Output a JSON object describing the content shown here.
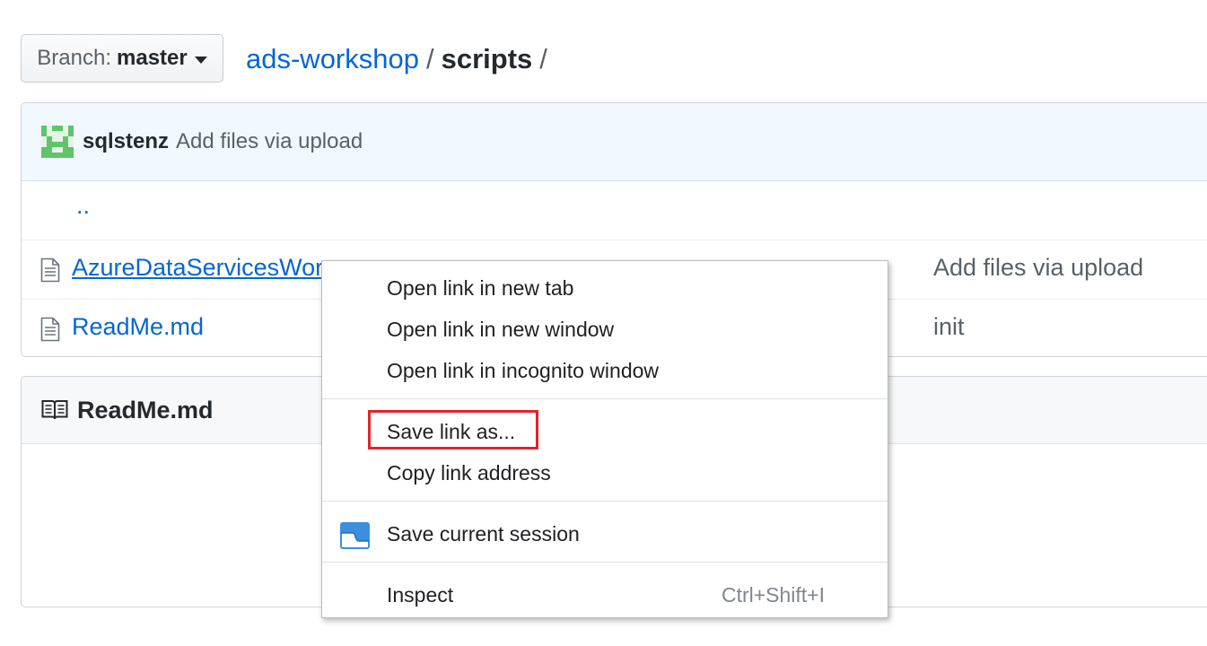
{
  "branch": {
    "label": "Branch:",
    "value": "master"
  },
  "breadcrumb": {
    "repo": "ads-workshop",
    "sep1": "/",
    "current": "scripts",
    "sep2": "/"
  },
  "commit": {
    "author": "sqlstenz",
    "message": "Add files via upload"
  },
  "files": {
    "parent": "..",
    "rows": [
      {
        "name": "AzureDataServicesWor",
        "message": "Add files via upload"
      },
      {
        "name": "ReadMe.md",
        "message": "init"
      }
    ]
  },
  "readme": {
    "title": "ReadMe.md"
  },
  "context_menu": {
    "open_new_tab": "Open link in new tab",
    "open_new_window": "Open link in new window",
    "open_incognito": "Open link in incognito window",
    "save_link_as": "Save link as...",
    "copy_link": "Copy link address",
    "save_session": "Save current session",
    "inspect": "Inspect",
    "inspect_shortcut": "Ctrl+Shift+I"
  },
  "colors": {
    "link": "#0366d6",
    "highlight": "#e0242c",
    "commit_bar": "#f1f8ff"
  }
}
